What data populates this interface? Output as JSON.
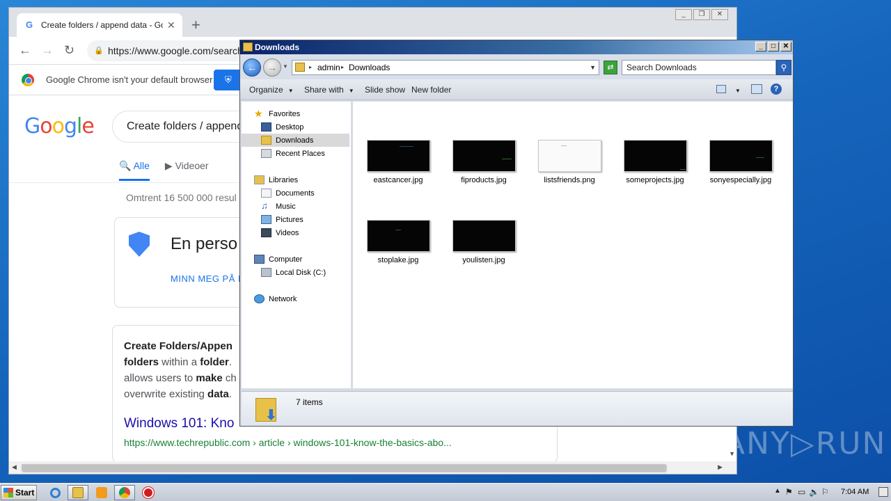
{
  "desktop": {
    "watermark": "ANY▷RUN"
  },
  "chrome": {
    "tab_title": "Create folders / append data - Goog",
    "tab_close": "✕",
    "new_tab": "+",
    "url": "https://www.google.com/search",
    "infobar_message": "Google Chrome isn't your default browser",
    "search_query": "Create folders / append",
    "tabs": [
      {
        "label": "Alle",
        "icon": "search-icon"
      },
      {
        "label": "Videoer",
        "icon": "video-icon"
      }
    ],
    "result_stats": "Omtrent 16 500 000 resul",
    "privacy_card_title": "En perso",
    "privacy_card_link": "MINN MEG PÅ D",
    "snippet_lines": [
      [
        "Create Folders/Appen",
        ""
      ],
      [
        "folders",
        " within a ",
        "folder",
        "."
      ],
      [
        "allows users to ",
        "make",
        " ch"
      ],
      [
        "overwrite existing ",
        "data",
        "."
      ]
    ],
    "result_title": "Windows 101: Kno",
    "result_url": "https://www.techrepublic.com › article › windows-101-know-the-basics-abo..."
  },
  "explorer": {
    "title": "Downloads",
    "breadcrumb": [
      "admin",
      "Downloads"
    ],
    "search_placeholder": "Search Downloads",
    "commands": {
      "organize": "Organize",
      "share_with": "Share with",
      "slide_show": "Slide show",
      "new_folder": "New folder"
    },
    "nav": {
      "favorites": "Favorites",
      "desktop": "Desktop",
      "downloads": "Downloads",
      "recent_places": "Recent Places",
      "libraries": "Libraries",
      "documents": "Documents",
      "music": "Music",
      "pictures": "Pictures",
      "videos": "Videos",
      "computer": "Computer",
      "local_disk": "Local Disk (C:)",
      "network": "Network"
    },
    "files": [
      {
        "name": "eastcancer.jpg",
        "thumb": "dark"
      },
      {
        "name": "fiproducts.jpg",
        "thumb": "dark"
      },
      {
        "name": "listsfriends.png",
        "thumb": "light"
      },
      {
        "name": "someprojects.jpg",
        "thumb": "dark"
      },
      {
        "name": "sonyespecially.jpg",
        "thumb": "dark"
      },
      {
        "name": "stoplake.jpg",
        "thumb": "dark"
      },
      {
        "name": "youlisten.jpg",
        "thumb": "dark"
      }
    ],
    "item_count": "7 items"
  },
  "taskbar": {
    "start_label": "Start",
    "clock": "7:04 AM"
  },
  "colors": {
    "chrome_blue": "#1a73e8",
    "xp_title_dark": "#0a246a",
    "desktop": "#1666bd"
  }
}
